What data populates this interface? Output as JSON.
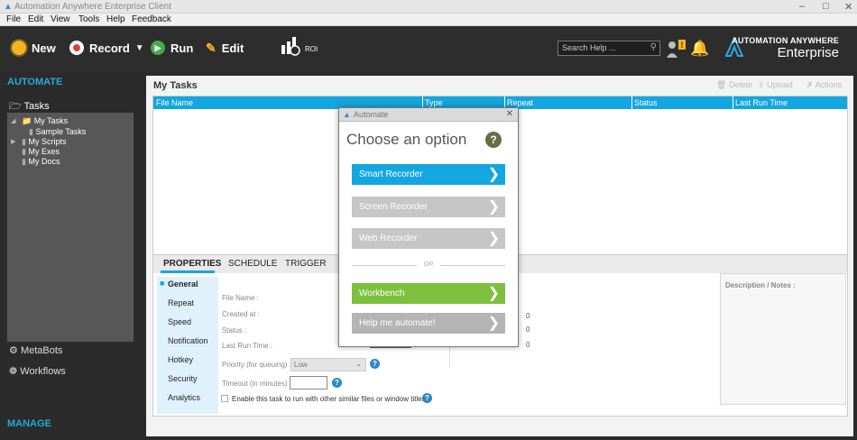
{
  "window": {
    "title": "Automation Anywhere Enterprise Client",
    "controls": [
      "–",
      "□",
      "✕"
    ]
  },
  "menu": [
    "File",
    "Edit",
    "View",
    "Tools",
    "Help",
    "Feedback"
  ],
  "toolbar": {
    "new": "New",
    "record": "Record",
    "run": "Run",
    "edit": "Edit",
    "roi": "ROI",
    "search_placeholder": "Search Help ...",
    "brand_line1": "AUTOMATION ANYWHERE",
    "brand_line2": "Enterprise"
  },
  "sidebar": {
    "automate": "AUTOMATE",
    "tasks": "Tasks",
    "tree": [
      "My Tasks",
      "Sample Tasks",
      "My Scripts",
      "My Exes",
      "My Docs"
    ],
    "metabots": "MetaBots",
    "workflows": "Workflows",
    "manage": "MANAGE"
  },
  "main": {
    "title": "My Tasks",
    "actions": [
      "Delete",
      "Upload",
      "Actions"
    ],
    "columns": [
      "File Name",
      "Type",
      "Repeat",
      "Status",
      "Last Run Time"
    ]
  },
  "props": {
    "tabs": [
      "PROPERTIES",
      "SCHEDULE",
      "TRIGGER"
    ],
    "side": [
      "General",
      "Repeat",
      "Speed",
      "Notification",
      "Hotkey",
      "Security",
      "Analytics"
    ],
    "fields": [
      "File Name :",
      "Created at :",
      "Status :",
      "Last Run Time :",
      "Priority (for queuing) :",
      "Timeout (in minutes) :"
    ],
    "priority_value": "Low",
    "checkbox_label": "Enable this task to run with other similar files or window titles",
    "zeros": [
      "0",
      "0",
      "0"
    ],
    "desc_label": "Description / Notes :"
  },
  "dialog": {
    "title": "Automate",
    "heading": "Choose an option",
    "options": [
      "Smart Recorder",
      "Screen Recorder",
      "Web Recorder",
      "Workbench",
      "Help me automate!"
    ],
    "or": "OR"
  }
}
